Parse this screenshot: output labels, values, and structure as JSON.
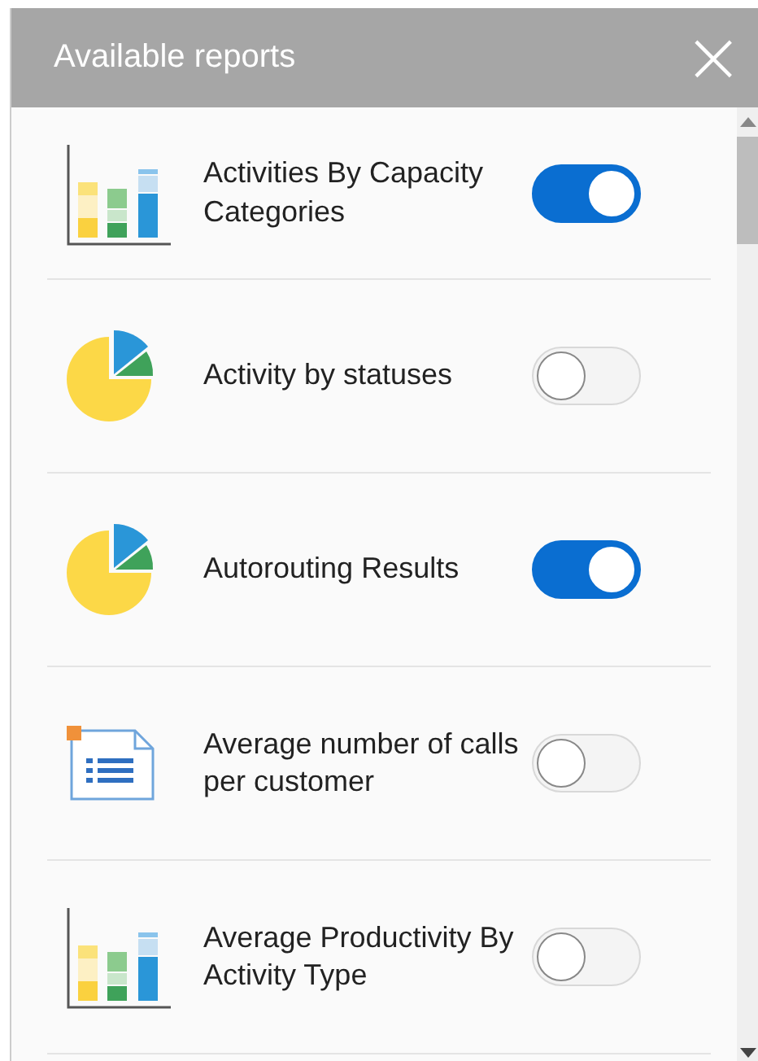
{
  "header": {
    "title": "Available reports",
    "close": "×"
  },
  "reports": [
    {
      "kind": "bar",
      "title": "Activities By Capacity Categories",
      "on": true
    },
    {
      "kind": "pie",
      "title": "Activity by statuses",
      "on": false
    },
    {
      "kind": "pie",
      "title": "Autorouting Results",
      "on": true
    },
    {
      "kind": "doc",
      "title": "Average number of calls per customer",
      "on": false
    },
    {
      "kind": "bar",
      "title": "Average Productivity By Activity Type",
      "on": false
    }
  ]
}
